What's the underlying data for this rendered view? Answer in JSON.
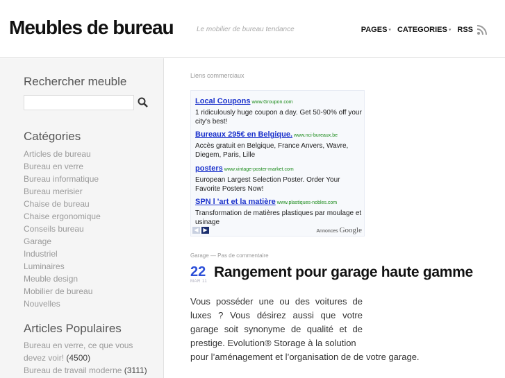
{
  "header": {
    "site_title": "Meubles de bureau",
    "tagline": "Le mobilier de bureau tendance",
    "nav": [
      {
        "label": "PAGES"
      },
      {
        "label": "CATEGORIES"
      },
      {
        "label": "RSS"
      }
    ]
  },
  "sidebar": {
    "search_heading": "Rechercher meuble",
    "search_value": "",
    "categories_heading": "Catégories",
    "categories": [
      "Articles de bureau",
      "Bureau en verre",
      "Bureau informatique",
      "Bureau merisier",
      "Chaise de bureau",
      "Chaise ergonomique",
      "Conseils bureau",
      "Garage",
      "Industriel",
      "Luminaires",
      "Meuble design",
      "Mobilier de bureau",
      "Nouvelles"
    ],
    "popular_heading": "Articles Populaires",
    "popular": [
      {
        "title": "Bureau en verre, ce que vous devez voir!",
        "count": "(4500)"
      },
      {
        "title": "Bureau de travail moderne",
        "count": "(3111)"
      }
    ]
  },
  "ads": {
    "label": "Liens commerciaux",
    "items": [
      {
        "title": "Local Coupons",
        "url": "www.Groupon.com",
        "desc": "1 ridiculously huge coupon a day. Get 50-90% off your city's best!"
      },
      {
        "title": "Bureaux 295€ en Belgique.",
        "url": "www.nci-bureaux.be",
        "desc": "Accès gratuit en Belgique, France Anvers, Wavre, Diegem, Paris, Lille"
      },
      {
        "title": "posters",
        "url": "www.vintage-poster-market.com",
        "desc": "European Largest Selection Poster. Order Your Favorite Posters Now!"
      },
      {
        "title": "SPN l 'art et la matière",
        "url": "www.plastiques-nobles.com",
        "desc": "Transformation de matières plastiques par moulage et usinage"
      }
    ],
    "brand_prefix": "Annonces",
    "brand_name": "Google"
  },
  "post": {
    "category": "Garage",
    "separator": "—",
    "comments": "Pas de commentaire",
    "day": "22",
    "month": "MAR 11",
    "title": "Rangement pour garage haute gamme",
    "body": "Vous posséder une ou des voitures de luxes ? Vous désirez aussi que votre garage soit synonyme de qualité et de prestige. Evolution® Storage à la solution",
    "body_last": "pour l’aménagement et l’organisation de de votre garage."
  },
  "colors": {
    "accent": "#2c4fd8",
    "ad_link": "#1c33cc",
    "ad_url": "#1b8b1b",
    "sidebar_bg": "#f5f5f5"
  },
  "icons": [
    "chevron-down-icon",
    "rss-icon",
    "search-icon",
    "arrow-left-icon",
    "arrow-right-icon"
  ]
}
